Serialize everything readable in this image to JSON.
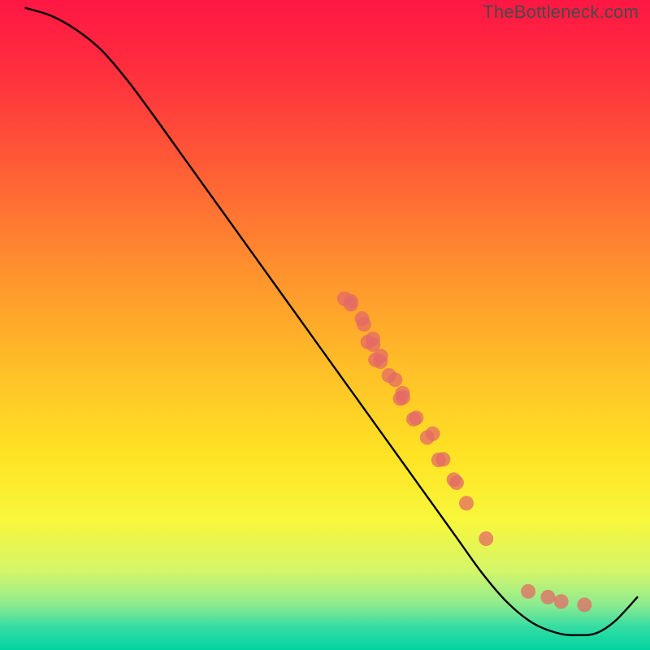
{
  "attribution": "TheBottleneck.com",
  "chart_data": {
    "type": "line",
    "title": "",
    "xlabel": "",
    "ylabel": "",
    "xlim": [
      0,
      100
    ],
    "ylim": [
      0,
      100
    ],
    "background_gradient_stops": [
      {
        "offset": 0.0,
        "color": "#ff1744"
      },
      {
        "offset": 0.1,
        "color": "#ff2c3e"
      },
      {
        "offset": 0.25,
        "color": "#ff5a36"
      },
      {
        "offset": 0.4,
        "color": "#ff8c2e"
      },
      {
        "offset": 0.55,
        "color": "#ffba28"
      },
      {
        "offset": 0.7,
        "color": "#ffe324"
      },
      {
        "offset": 0.8,
        "color": "#f8f73a"
      },
      {
        "offset": 0.88,
        "color": "#d3f56a"
      },
      {
        "offset": 0.93,
        "color": "#8eeb8f"
      },
      {
        "offset": 0.965,
        "color": "#34dca4"
      },
      {
        "offset": 1.0,
        "color": "#00d4a0"
      }
    ],
    "curve": [
      {
        "x": 2.0,
        "y": 99.0
      },
      {
        "x": 6.0,
        "y": 97.8
      },
      {
        "x": 10.0,
        "y": 95.6
      },
      {
        "x": 14.0,
        "y": 92.4
      },
      {
        "x": 18.0,
        "y": 87.8
      },
      {
        "x": 22.0,
        "y": 82.5
      },
      {
        "x": 26.0,
        "y": 77.0
      },
      {
        "x": 30.0,
        "y": 71.5
      },
      {
        "x": 34.0,
        "y": 66.0
      },
      {
        "x": 38.0,
        "y": 60.5
      },
      {
        "x": 42.0,
        "y": 55.0
      },
      {
        "x": 46.0,
        "y": 49.5
      },
      {
        "x": 50.0,
        "y": 44.0
      },
      {
        "x": 54.0,
        "y": 38.5
      },
      {
        "x": 58.0,
        "y": 33.0
      },
      {
        "x": 62.0,
        "y": 27.5
      },
      {
        "x": 66.0,
        "y": 22.0
      },
      {
        "x": 70.0,
        "y": 16.5
      },
      {
        "x": 74.0,
        "y": 11.0
      },
      {
        "x": 78.0,
        "y": 6.4
      },
      {
        "x": 82.0,
        "y": 3.2
      },
      {
        "x": 86.0,
        "y": 1.6
      },
      {
        "x": 89.0,
        "y": 1.3
      },
      {
        "x": 92.0,
        "y": 1.6
      },
      {
        "x": 95.0,
        "y": 3.5
      },
      {
        "x": 98.5,
        "y": 7.2
      }
    ],
    "marker_groups": [
      {
        "cx": 52.8,
        "cy": 53.3,
        "count": 3
      },
      {
        "cx": 55.2,
        "cy": 50.2,
        "count": 2
      },
      {
        "cx": 56.4,
        "cy": 47.0,
        "count": 3
      },
      {
        "cx": 57.6,
        "cy": 44.3,
        "count": 3
      },
      {
        "cx": 59.8,
        "cy": 41.6,
        "count": 2
      },
      {
        "cx": 61.3,
        "cy": 38.5,
        "count": 3
      },
      {
        "cx": 63.4,
        "cy": 35.3,
        "count": 2
      },
      {
        "cx": 65.8,
        "cy": 32.2,
        "count": 2
      },
      {
        "cx": 67.5,
        "cy": 28.9,
        "count": 2
      },
      {
        "cx": 69.8,
        "cy": 25.5,
        "count": 2
      },
      {
        "cx": 72.0,
        "cy": 21.4,
        "count": 1
      },
      {
        "cx": 74.8,
        "cy": 16.0,
        "count": 1
      },
      {
        "cx": 81.5,
        "cy": 8.5,
        "count": 1
      },
      {
        "cx": 84.4,
        "cy": 6.8,
        "count": 1
      },
      {
        "cx": 87.0,
        "cy": 6.2,
        "count": 1
      },
      {
        "cx": 90.0,
        "cy": 6.1,
        "count": 1
      }
    ],
    "marker_color": "#e46a66",
    "marker_opacity": 0.75,
    "marker_radius": 9,
    "line_color": "#000000",
    "line_width": 2.4,
    "plot_inset": {
      "left": 16,
      "right": 4,
      "top": 2,
      "bottom": 8
    }
  }
}
